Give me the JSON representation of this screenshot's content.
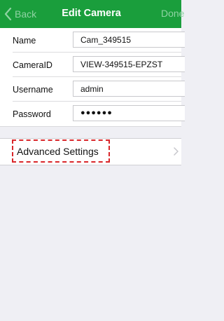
{
  "navbar": {
    "back_label": "Back",
    "title": "Edit Camera",
    "done_label": "Done",
    "background_color": "#1a9e3c"
  },
  "form": {
    "rows": [
      {
        "label": "Name",
        "value": "Cam_349515"
      },
      {
        "label": "CameraID",
        "value": "VIEW-349515-EPZST"
      },
      {
        "label": "Username",
        "value": "admin"
      },
      {
        "label": "Password",
        "value": "●●●●●●"
      }
    ]
  },
  "advanced": {
    "label": "Advanced Settings",
    "highlight_color": "#d9262a"
  }
}
